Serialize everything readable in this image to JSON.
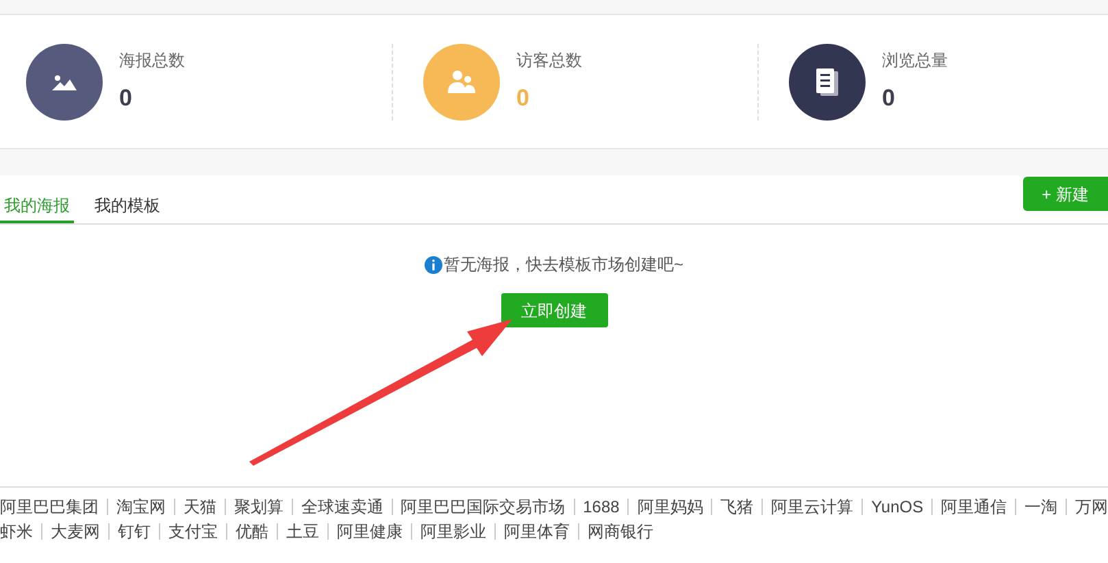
{
  "stats": [
    {
      "kind": "posters",
      "label": "海报总数",
      "value": "0"
    },
    {
      "kind": "visitors",
      "label": "访客总数",
      "value": "0"
    },
    {
      "kind": "views",
      "label": "浏览总量",
      "value": "0"
    }
  ],
  "tabs": [
    {
      "label": "我的海报",
      "selected": true
    },
    {
      "label": "我的模板",
      "selected": false
    }
  ],
  "new_button": "+ 新建",
  "empty_message": "暂无海报，快去模板市场创建吧~",
  "create_button": "立即创建",
  "footer_links": [
    [
      "阿里巴巴集团",
      "淘宝网",
      "天猫",
      "聚划算",
      "全球速卖通",
      "阿里巴巴国际交易市场",
      "1688",
      "阿里妈妈",
      "飞猪",
      "阿里云计算",
      "YunOS",
      "阿里通信",
      "一淘",
      "万网"
    ],
    [
      "虾米",
      "大麦网",
      "钉钉",
      "支付宝",
      "优酷",
      "土豆",
      "阿里健康",
      "阿里影业",
      "阿里体育",
      "网商银行"
    ]
  ]
}
